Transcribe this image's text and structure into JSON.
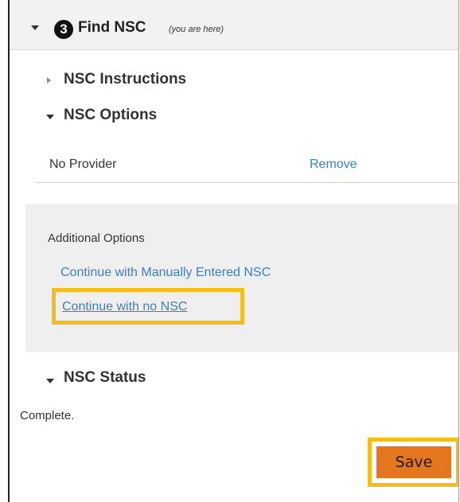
{
  "header": {
    "step_number": "3",
    "title": "Find NSC",
    "note": "(you are here)"
  },
  "sections": {
    "instructions_label": "NSC Instructions",
    "options_label": "NSC Options",
    "status_label": "NSC Status"
  },
  "provider": {
    "name": "No Provider",
    "remove_label": "Remove"
  },
  "additional_options": {
    "heading": "Additional Options",
    "manual_link": "Continue with Manually Entered NSC",
    "no_nsc_link": "Continue with no NSC"
  },
  "status": {
    "text": "Complete."
  },
  "actions": {
    "save_label": "Save"
  },
  "colors": {
    "link": "#3d7fc0",
    "highlight": "#f5bd1a",
    "save_button": "#e3761f"
  }
}
